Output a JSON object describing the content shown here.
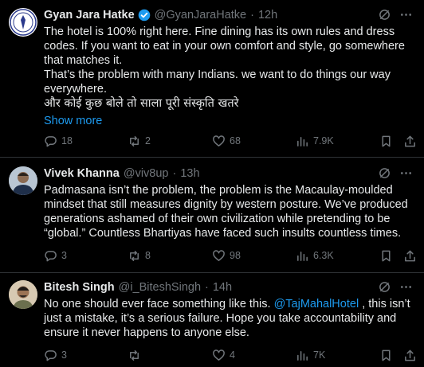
{
  "tweets": [
    {
      "name": "Gyan Jara Hatke",
      "handle": "@GyanJaraHatke",
      "time": "12h",
      "verified": true,
      "lines": [
        "The hotel is 100% right here. Fine dining has its own rules and dress codes. If you want to eat in your own comfort and style, go somewhere that matches it.",
        "That’s the problem with many Indians. we want to do things our way everywhere.",
        "और कोई कुछ बोले तो साला पूरी संस्कृति खतरे"
      ],
      "show_more": "Show more",
      "replies": "18",
      "reposts": "2",
      "likes": "68",
      "views": "7.9K"
    },
    {
      "name": "Vivek Khanna",
      "handle": "@viv8up",
      "time": "13h",
      "text": "Padmasana isn’t the problem, the problem is the Macaulay-moulded mindset that still measures dignity by western posture. We’ve produced generations ashamed of their own civilization while pretending to be “global.” Countless Bhartiyas have faced such insults countless times.",
      "replies": "3",
      "reposts": "8",
      "likes": "98",
      "views": "6.3K"
    },
    {
      "name": "Bitesh Singh",
      "handle": "@i_BiteshSingh",
      "time": "14h",
      "text_before": "No one should ever face something like this. ",
      "mention": "@TajMahalHotel",
      "text_after": " , this isn’t just a mistake, it’s a serious failure. Hope you take accountability and ensure it never happens to anyone else.",
      "replies": "3",
      "reposts": "",
      "likes": "4",
      "views": "7K"
    }
  ],
  "separator": "·",
  "colors": {
    "background": "#000000",
    "text": "#e7e9ea",
    "muted": "#71767b",
    "link": "#1d9bf0",
    "divider": "#2f3336"
  },
  "icons": [
    "grok-icon",
    "more-icon",
    "reply-icon",
    "repost-icon",
    "like-icon",
    "views-icon",
    "bookmark-icon",
    "share-icon",
    "verified-badge-icon"
  ]
}
